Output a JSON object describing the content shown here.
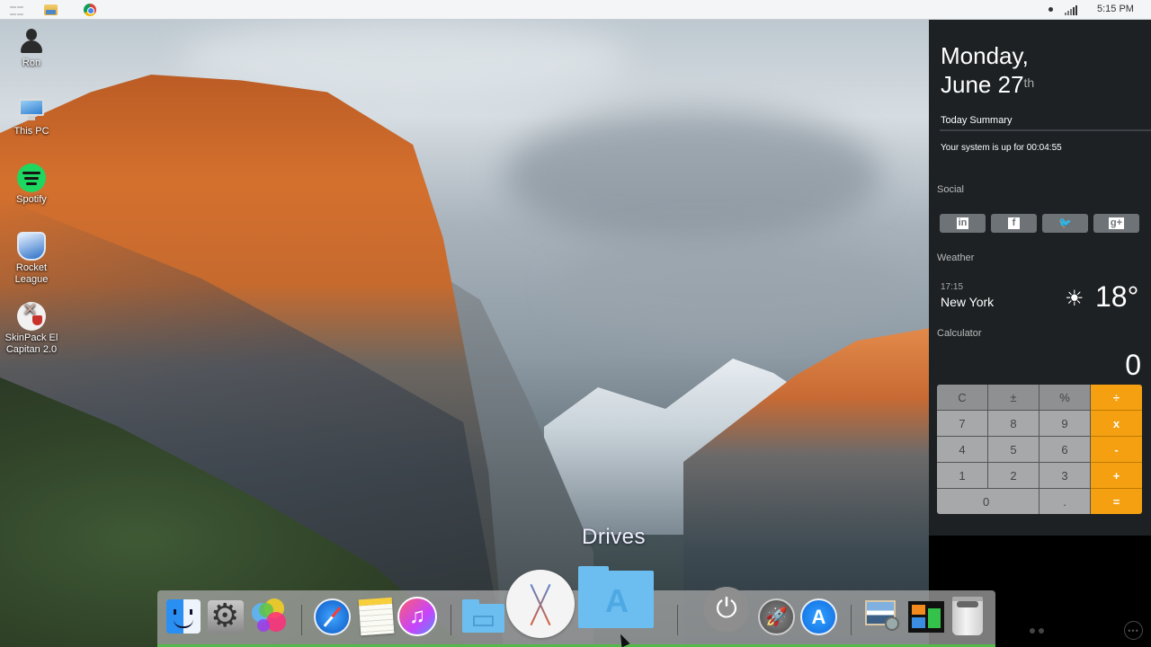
{
  "taskbar": {
    "pinned": [
      {
        "name": "start",
        "icon": "windows-logo-icon"
      },
      {
        "name": "file-explorer",
        "icon": "folder-icon"
      },
      {
        "name": "chrome",
        "icon": "chrome-icon"
      }
    ],
    "tray": {
      "notification_icon": "dot-icon",
      "network_icon": "signal-bars-icon",
      "clock": "5:15 PM"
    }
  },
  "desktop_icons": [
    {
      "label": "Ron",
      "icon": "user-icon"
    },
    {
      "label": "This PC",
      "icon": "computer-icon"
    },
    {
      "label": "Spotify",
      "icon": "spotify-icon"
    },
    {
      "label": "Rocket League",
      "icon": "rocket-league-icon"
    },
    {
      "label": "SkinPack El Capitan 2.0",
      "icon": "skinpack-icon"
    }
  ],
  "sidebar": {
    "date_line1": "Monday,",
    "date_line2": "June 27",
    "date_suffix": "th",
    "summary_title": "Today Summary",
    "uptime": "Your system is up for 00:04:55",
    "social_title": "Social",
    "social_buttons": [
      {
        "network": "LinkedIn",
        "glyph": "in"
      },
      {
        "network": "Facebook",
        "glyph": "f"
      },
      {
        "network": "Twitter",
        "glyph": "🐦"
      },
      {
        "network": "Google+",
        "glyph": "g+"
      }
    ],
    "weather_title": "Weather",
    "weather": {
      "time": "17:15",
      "city": "New York",
      "condition_icon": "sun-icon",
      "glyph": "☀",
      "temperature": "18°"
    },
    "calculator_title": "Calculator",
    "calculator": {
      "display": "0",
      "keys": [
        [
          "C",
          "±",
          "%",
          "÷"
        ],
        [
          "7",
          "8",
          "9",
          "x"
        ],
        [
          "4",
          "5",
          "6",
          "-"
        ],
        [
          "1",
          "2",
          "3",
          "+"
        ],
        [
          "0",
          ".",
          "="
        ]
      ]
    },
    "more_label": "•••"
  },
  "dock": {
    "hover_label": "Drives",
    "items": [
      {
        "name": "Finder"
      },
      {
        "name": "System Preferences"
      },
      {
        "name": "Game Center"
      },
      {
        "name": "Safari"
      },
      {
        "name": "Notes"
      },
      {
        "name": "iTunes",
        "glyph": "♫"
      },
      {
        "name": "Drives"
      },
      {
        "name": "El Capitan"
      },
      {
        "name": "Applications"
      },
      {
        "name": "Power",
        "glyph": "⏻"
      },
      {
        "name": "Launchpad",
        "glyph": "🚀"
      },
      {
        "name": "App Store",
        "glyph": "A"
      },
      {
        "name": "Preview"
      },
      {
        "name": "Mission Control"
      },
      {
        "name": "Trash"
      }
    ]
  },
  "colors": {
    "calc_operator": "#f4a011",
    "sidebar_bg": "#1d2124",
    "dock_accent": "#54b94a"
  }
}
